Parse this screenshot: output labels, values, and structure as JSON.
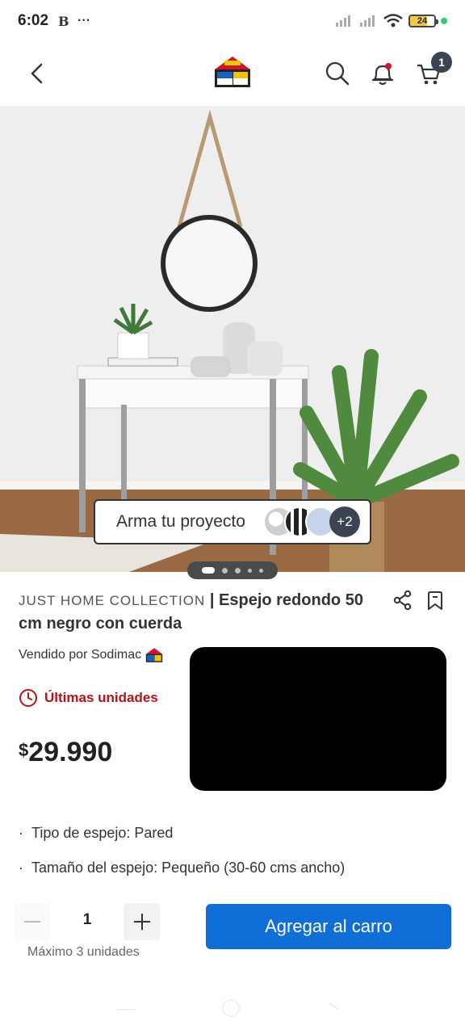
{
  "status_bar": {
    "time": "6:02",
    "left_icons": [
      "notification-icon",
      "more-icon"
    ],
    "more_label": "···",
    "battery": "24",
    "colors": {
      "battery_fill": "#f2c94c",
      "dot": "#2ecc71"
    }
  },
  "header": {
    "icons": [
      "back-icon",
      "logo",
      "search-icon",
      "bell-icon",
      "cart-icon"
    ],
    "cart_count": "1",
    "bell_dot_color": "#d1122b"
  },
  "gallery": {
    "project_chip": {
      "label": "Arma tu proyecto",
      "more": "+2"
    },
    "pager": {
      "total": 5,
      "active": 1
    }
  },
  "product": {
    "brand": "JUST HOME COLLECTION",
    "separator": "|",
    "name": "Espejo redondo 50 cm negro con cuerda",
    "seller": "Vendido por Sodimac",
    "stock_label": "Últimas unidades",
    "price_symbol": "$",
    "price": "29.990",
    "specs": [
      "Tipo de espejo: Pared",
      "Tamaño del espejo: Pequeño (30-60 cms ancho)"
    ]
  },
  "purchase": {
    "quantity": "1",
    "max_label": "Máximo 3 unidades",
    "add_button": "Agregar al carro"
  },
  "colors": {
    "accent": "#0f6fd6",
    "alert": "#b5121b",
    "badge": "#3d4451"
  }
}
